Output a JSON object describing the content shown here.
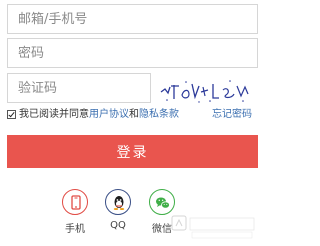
{
  "fields": {
    "account_placeholder": "邮箱/手机号",
    "password_placeholder": "密码",
    "captcha_placeholder": "验证码"
  },
  "agreement": {
    "prefix": "我已阅读并同意",
    "user_agreement": "用户协议",
    "conjunction": "和",
    "privacy_terms": "隐私条款",
    "forgot_password": "忘记密码"
  },
  "login_button": "登录",
  "social": {
    "phone_label": "手机",
    "qq_label": "QQ",
    "wechat_label": "微信"
  },
  "colors": {
    "login_button": "#e9554e",
    "link": "#3b6fb0",
    "phone": "#e14b44",
    "qq": "#3a4f86",
    "wechat": "#3fae47"
  }
}
